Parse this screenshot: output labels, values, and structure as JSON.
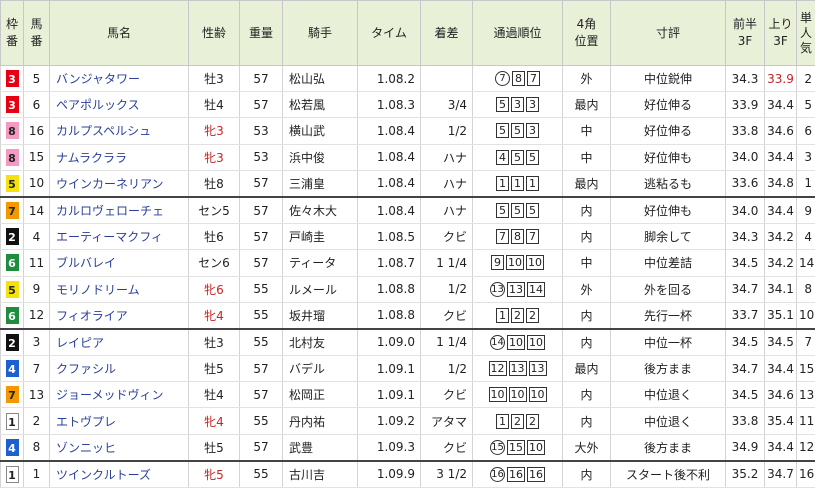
{
  "headers": {
    "waku": [
      "枠",
      "番"
    ],
    "umaban": [
      "馬",
      "番"
    ],
    "name": "馬名",
    "sexage": "性齢",
    "weight": "重量",
    "jockey": "騎手",
    "time": "タイム",
    "margin": "着差",
    "passing": "通過順位",
    "corner4": [
      "4角",
      "位置"
    ],
    "comment": "寸評",
    "first3f": [
      "前半",
      "3F"
    ],
    "last3f": [
      "上り",
      "3F"
    ],
    "popularity": [
      "単",
      "人",
      "気"
    ]
  },
  "colors": {
    "header_bg": "#e8f0d8",
    "horse_name": "#2a3f9a",
    "mare_text": "#cc2222",
    "fastest_last3f": "#cc2222",
    "waku": {
      "1": "#ffffff",
      "2": "#111111",
      "3": "#e60012",
      "4": "#1e5fd0",
      "5": "#f4e20a",
      "6": "#1e8e3e",
      "7": "#f39800",
      "8": "#f49ac2"
    }
  },
  "rows": [
    {
      "waku": "3",
      "umaban": "5",
      "name": "バンジャタワー",
      "sexage": "牡3",
      "mare": false,
      "weight": "57",
      "jockey": "松山弘",
      "time": "1.08.2",
      "margin": "",
      "pass_first": "7",
      "pass_first_circled": true,
      "pass_rest": [
        "8",
        "7"
      ],
      "corner": "外",
      "comment": "中位鋭伸",
      "f3": "34.3",
      "l3": "33.9",
      "l3_fastest": true,
      "pop": "2"
    },
    {
      "waku": "3",
      "umaban": "6",
      "name": "ペアポルックス",
      "sexage": "牡4",
      "mare": false,
      "weight": "57",
      "jockey": "松若風",
      "time": "1.08.3",
      "margin": "3/4",
      "pass_first": "5",
      "pass_first_circled": false,
      "pass_rest": [
        "3",
        "3"
      ],
      "corner": "最内",
      "comment": "好位伸る",
      "f3": "33.9",
      "l3": "34.4",
      "l3_fastest": false,
      "pop": "5"
    },
    {
      "waku": "8",
      "umaban": "16",
      "name": "カルプスペルシュ",
      "sexage": "牝3",
      "mare": true,
      "weight": "53",
      "jockey": "横山武",
      "time": "1.08.4",
      "margin": "1/2",
      "pass_first": "5",
      "pass_first_circled": false,
      "pass_rest": [
        "5",
        "3"
      ],
      "corner": "中",
      "comment": "好位伸る",
      "f3": "33.8",
      "l3": "34.6",
      "l3_fastest": false,
      "pop": "6"
    },
    {
      "waku": "8",
      "umaban": "15",
      "name": "ナムラクララ",
      "sexage": "牝3",
      "mare": true,
      "weight": "53",
      "jockey": "浜中俊",
      "time": "1.08.4",
      "margin": "ハナ",
      "pass_first": "4",
      "pass_first_circled": false,
      "pass_rest": [
        "5",
        "5"
      ],
      "corner": "中",
      "comment": "好位伸も",
      "f3": "34.0",
      "l3": "34.4",
      "l3_fastest": false,
      "pop": "3"
    },
    {
      "waku": "5",
      "umaban": "10",
      "name": "ウインカーネリアン",
      "sexage": "牡8",
      "mare": false,
      "weight": "57",
      "jockey": "三浦皇",
      "time": "1.08.4",
      "margin": "ハナ",
      "pass_first": "1",
      "pass_first_circled": false,
      "pass_rest": [
        "1",
        "1"
      ],
      "corner": "最内",
      "comment": "逃粘るも",
      "f3": "33.6",
      "l3": "34.8",
      "l3_fastest": false,
      "pop": "1",
      "sep": true
    },
    {
      "waku": "7",
      "umaban": "14",
      "name": "カルロヴェローチェ",
      "sexage": "セン5",
      "mare": false,
      "weight": "57",
      "jockey": "佐々木大",
      "time": "1.08.4",
      "margin": "ハナ",
      "pass_first": "5",
      "pass_first_circled": false,
      "pass_rest": [
        "5",
        "5"
      ],
      "corner": "内",
      "comment": "好位伸も",
      "f3": "34.0",
      "l3": "34.4",
      "l3_fastest": false,
      "pop": "9"
    },
    {
      "waku": "2",
      "umaban": "4",
      "name": "エーティーマクフィ",
      "sexage": "牡6",
      "mare": false,
      "weight": "57",
      "jockey": "戸崎圭",
      "time": "1.08.5",
      "margin": "クビ",
      "pass_first": "7",
      "pass_first_circled": false,
      "pass_rest": [
        "8",
        "7"
      ],
      "corner": "内",
      "comment": "脚余して",
      "f3": "34.3",
      "l3": "34.2",
      "l3_fastest": false,
      "pop": "4"
    },
    {
      "waku": "6",
      "umaban": "11",
      "name": "ブルバレイ",
      "sexage": "セン6",
      "mare": false,
      "weight": "57",
      "jockey": "ティータ",
      "time": "1.08.7",
      "margin": "1 1/4",
      "pass_first": "9",
      "pass_first_circled": false,
      "pass_rest": [
        "10",
        "10"
      ],
      "corner": "中",
      "comment": "中位差詰",
      "f3": "34.5",
      "l3": "34.2",
      "l3_fastest": false,
      "pop": "14"
    },
    {
      "waku": "5",
      "umaban": "9",
      "name": "モリノドリーム",
      "sexage": "牝6",
      "mare": true,
      "weight": "55",
      "jockey": "ルメール",
      "time": "1.08.8",
      "margin": "1/2",
      "pass_first": "13",
      "pass_first_circled": true,
      "pass_rest": [
        "13",
        "14"
      ],
      "corner": "外",
      "comment": "外を回る",
      "f3": "34.7",
      "l3": "34.1",
      "l3_fastest": false,
      "pop": "8"
    },
    {
      "waku": "6",
      "umaban": "12",
      "name": "フィオライア",
      "sexage": "牝4",
      "mare": true,
      "weight": "55",
      "jockey": "坂井瑠",
      "time": "1.08.8",
      "margin": "クビ",
      "pass_first": "1",
      "pass_first_circled": false,
      "pass_rest": [
        "2",
        "2"
      ],
      "corner": "内",
      "comment": "先行一杯",
      "f3": "33.7",
      "l3": "35.1",
      "l3_fastest": false,
      "pop": "10",
      "sep": true
    },
    {
      "waku": "2",
      "umaban": "3",
      "name": "レイピア",
      "sexage": "牡3",
      "mare": false,
      "weight": "55",
      "jockey": "北村友",
      "time": "1.09.0",
      "margin": "1 1/4",
      "pass_first": "14",
      "pass_first_circled": true,
      "pass_rest": [
        "10",
        "10"
      ],
      "corner": "内",
      "comment": "中位一杯",
      "f3": "34.5",
      "l3": "34.5",
      "l3_fastest": false,
      "pop": "7"
    },
    {
      "waku": "4",
      "umaban": "7",
      "name": "クファシル",
      "sexage": "牡5",
      "mare": false,
      "weight": "57",
      "jockey": "バデル",
      "time": "1.09.1",
      "margin": "1/2",
      "pass_first": "12",
      "pass_first_circled": false,
      "pass_rest": [
        "13",
        "13"
      ],
      "corner": "最内",
      "comment": "後方まま",
      "f3": "34.7",
      "l3": "34.4",
      "l3_fastest": false,
      "pop": "15"
    },
    {
      "waku": "7",
      "umaban": "13",
      "name": "ジョーメッドヴィン",
      "sexage": "牡4",
      "mare": false,
      "weight": "57",
      "jockey": "松岡正",
      "time": "1.09.1",
      "margin": "クビ",
      "pass_first": "10",
      "pass_first_circled": false,
      "pass_rest": [
        "10",
        "10"
      ],
      "corner": "内",
      "comment": "中位退く",
      "f3": "34.5",
      "l3": "34.6",
      "l3_fastest": false,
      "pop": "13"
    },
    {
      "waku": "1",
      "umaban": "2",
      "name": "エトヴプレ",
      "sexage": "牝4",
      "mare": true,
      "weight": "55",
      "jockey": "丹内祐",
      "time": "1.09.2",
      "margin": "アタマ",
      "pass_first": "1",
      "pass_first_circled": false,
      "pass_rest": [
        "2",
        "2"
      ],
      "corner": "内",
      "comment": "中位退く",
      "f3": "33.8",
      "l3": "35.4",
      "l3_fastest": false,
      "pop": "11"
    },
    {
      "waku": "4",
      "umaban": "8",
      "name": "ゾンニッヒ",
      "sexage": "牡5",
      "mare": false,
      "weight": "57",
      "jockey": "武豊",
      "time": "1.09.3",
      "margin": "クビ",
      "pass_first": "15",
      "pass_first_circled": true,
      "pass_rest": [
        "15",
        "10"
      ],
      "corner": "大外",
      "comment": "後方まま",
      "f3": "34.9",
      "l3": "34.4",
      "l3_fastest": false,
      "pop": "12",
      "sep": true
    },
    {
      "waku": "1",
      "umaban": "1",
      "name": "ツインクルトーズ",
      "sexage": "牝5",
      "mare": true,
      "weight": "55",
      "jockey": "古川吉",
      "time": "1.09.9",
      "margin": "3 1/2",
      "pass_first": "16",
      "pass_first_circled": true,
      "pass_rest": [
        "16",
        "16"
      ],
      "corner": "内",
      "comment": "スタート後不利",
      "f3": "35.2",
      "l3": "34.7",
      "l3_fastest": false,
      "pop": "16"
    }
  ]
}
